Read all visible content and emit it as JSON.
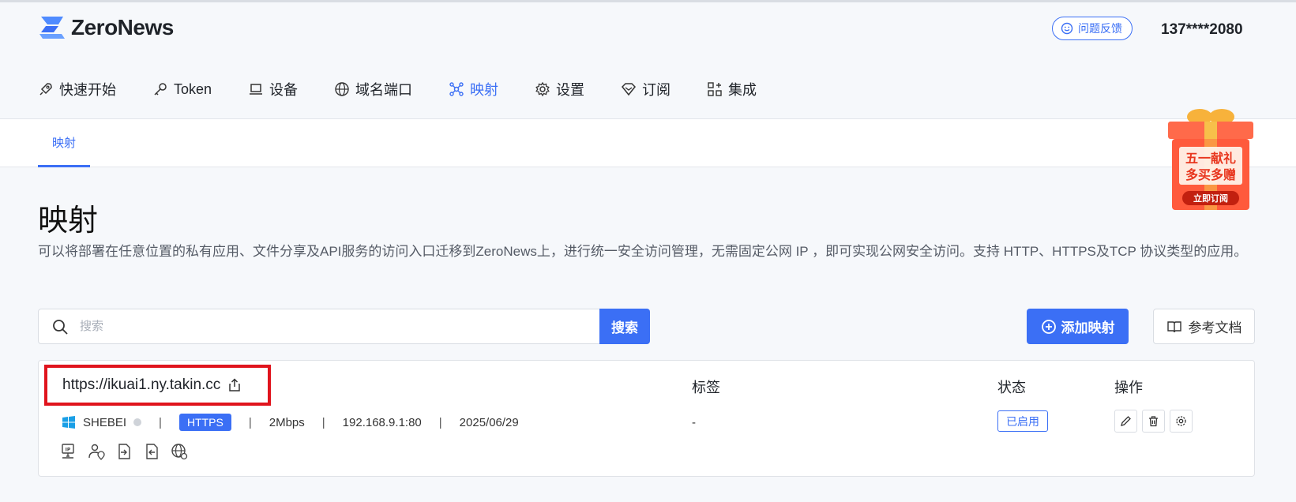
{
  "app": {
    "logo_text": "ZeroNews",
    "feedback_label": "问题反馈",
    "user_phone": "137****2080"
  },
  "nav": [
    {
      "label": "快速开始",
      "icon": "rocket-icon"
    },
    {
      "label": "Token",
      "icon": "key-icon"
    },
    {
      "label": "设备",
      "icon": "laptop-icon"
    },
    {
      "label": "域名端口",
      "icon": "globe-icon"
    },
    {
      "label": "映射",
      "icon": "mapping-icon",
      "active": true
    },
    {
      "label": "设置",
      "icon": "gear-icon"
    },
    {
      "label": "订阅",
      "icon": "diamond-icon"
    },
    {
      "label": "集成",
      "icon": "apps-icon"
    }
  ],
  "subtab": {
    "label": "映射"
  },
  "promo": {
    "line1": "五一献礼",
    "line2": "多买多赠",
    "cta": "立即订阅"
  },
  "page": {
    "title": "映射",
    "description": "可以将部署在任意位置的私有应用、文件分享及API服务的访问入口迁移到ZeroNews上，进行统一安全访问管理，无需固定公网 IP ，即可实现公网安全访问。支持 HTTP、HTTPS及TCP 协议类型的应用。"
  },
  "search": {
    "placeholder": "搜索",
    "button_label": "搜索"
  },
  "actions": {
    "add_label": "添加映射",
    "docs_label": "参考文档"
  },
  "columns": {
    "tags": "标签",
    "status": "状态",
    "operations": "操作"
  },
  "mapping": {
    "url": "https://ikuai1.ny.takin.cc",
    "device": "SHEBEI",
    "protocol": "HTTPS",
    "bandwidth": "2Mbps",
    "target": "192.168.9.1:80",
    "date": "2025/06/29",
    "tags": "-",
    "status": "已启用"
  },
  "colors": {
    "accent": "#3b6ff5",
    "highlight": "#e0141d"
  }
}
